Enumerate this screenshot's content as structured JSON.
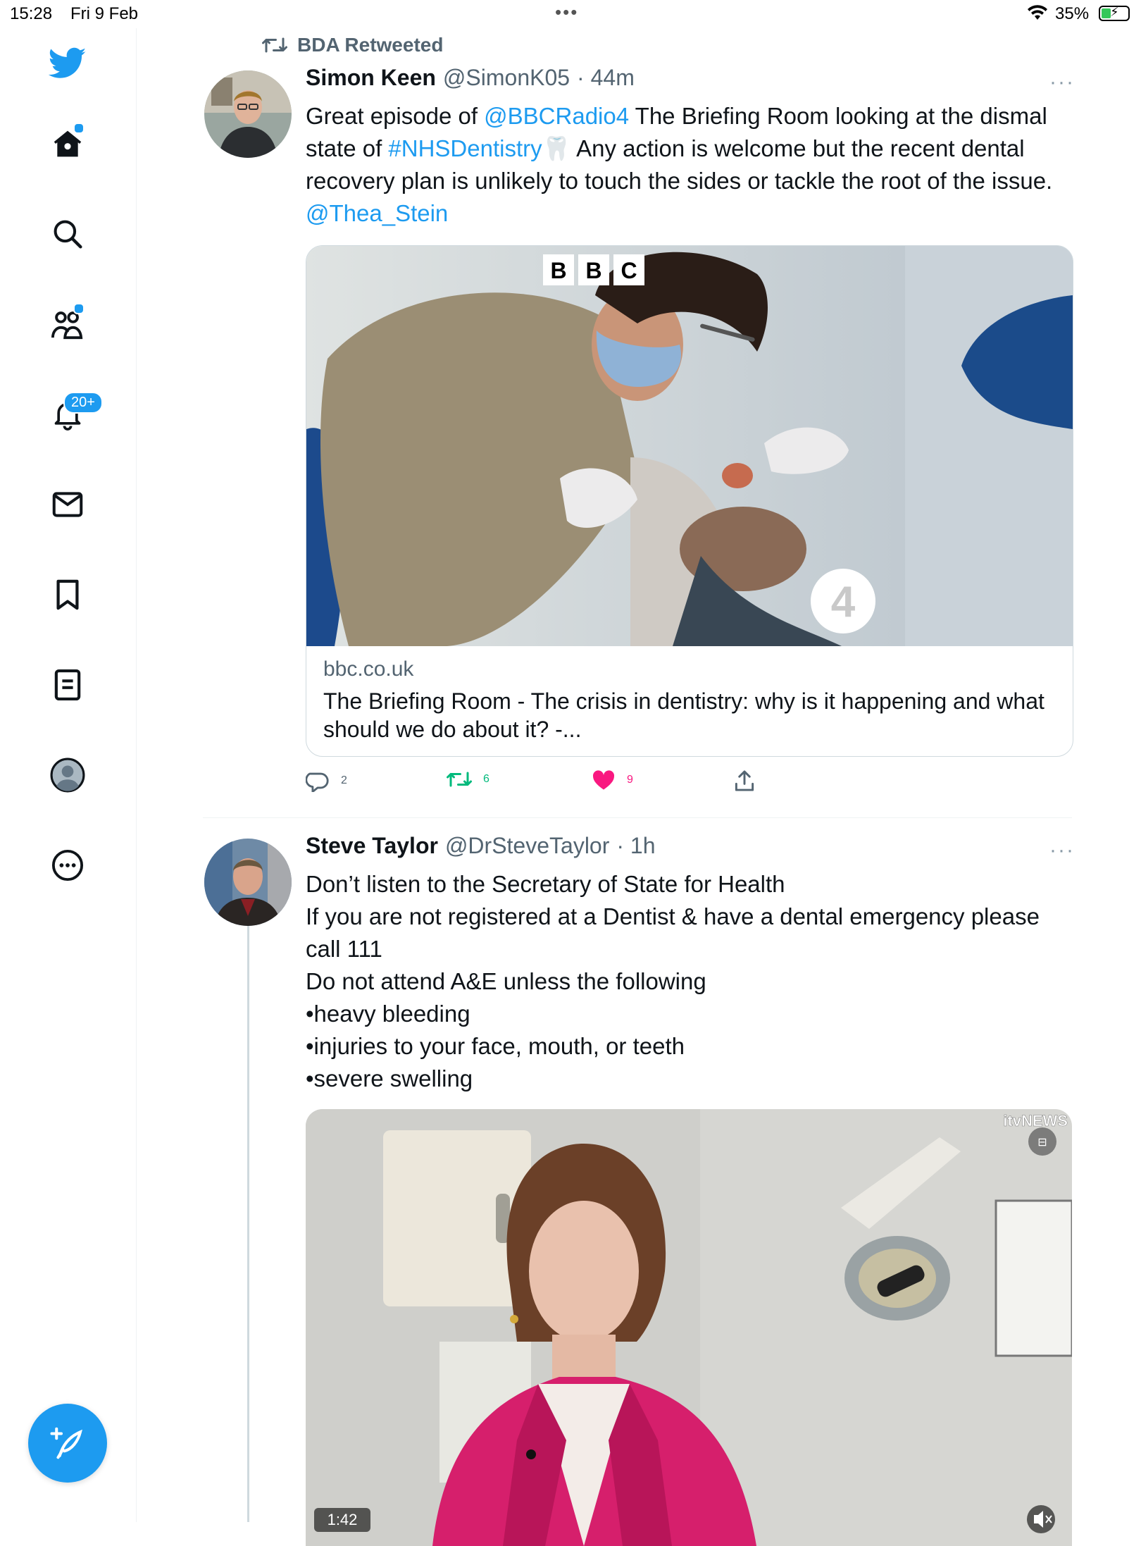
{
  "status_bar": {
    "time": "15:28",
    "date": "Fri 9 Feb",
    "battery": "35%",
    "battery_level": 0.35
  },
  "sidebar": {
    "items": [
      {
        "icon": "twitter-logo-icon"
      },
      {
        "icon": "home-icon",
        "has_dot": true
      },
      {
        "icon": "search-icon"
      },
      {
        "icon": "communities-icon",
        "has_dot": true
      },
      {
        "icon": "bell-icon",
        "badge": "20+"
      },
      {
        "icon": "mail-icon"
      },
      {
        "icon": "bookmark-icon"
      },
      {
        "icon": "lists-icon"
      },
      {
        "icon": "profile-icon"
      },
      {
        "icon": "more-circle-icon"
      }
    ],
    "compose_icon": "feather-plus-icon"
  },
  "tweets": [
    {
      "retweet_label": "BDA Retweeted",
      "name": "Simon Keen",
      "handle": "@SimonK05",
      "time": "· 44m",
      "more": "···",
      "text": {
        "p1": "Great episode of ",
        "mention1": "@BBCRadio4",
        "p2": " The Briefing Room looking at the dismal state of ",
        "hashtag": "#NHSDentistry",
        "p3": "🦷 Any action is welcome but the recent dental recovery plan is unlikely to touch the sides or tackle the root of the issue. ",
        "mention2": "@Thea_Stein"
      },
      "card": {
        "image_logo_letters": [
          "B",
          "B",
          "C"
        ],
        "image_badge": "4",
        "domain": "bbc.co.uk",
        "title": "The Briefing Room - The crisis in dentistry: why is it happening and what should we do about it? -..."
      },
      "actions": {
        "replies": "2",
        "retweets": "6",
        "likes": "9"
      }
    },
    {
      "name": "Steve Taylor",
      "handle": "@DrSteveTaylor",
      "time": "· 1h",
      "more": "···",
      "lines": [
        "Don’t listen to the Secretary of State for Health",
        "If you are not registered at a Dentist & have a dental emergency please call 111",
        "Do not attend A&E unless the following",
        "•heavy bleeding",
        "•injuries to your face, mouth, or teeth",
        "•severe swelling"
      ],
      "video": {
        "channel_logo": "itvNEWS",
        "duration": "1:42"
      }
    }
  ],
  "colors": {
    "accent": "#1d9bf0",
    "retweet_green": "#00ba7c",
    "like_pink": "#f91880",
    "secondary_text": "#536471"
  }
}
